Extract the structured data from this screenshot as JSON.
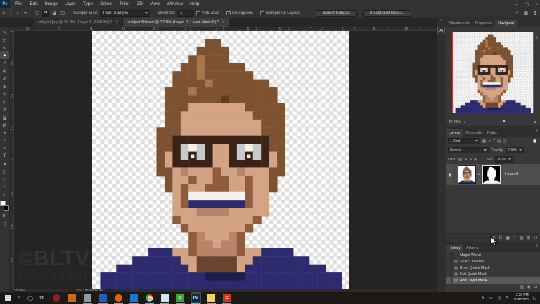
{
  "app": {
    "logo": "Ps",
    "window_controls": {
      "minimize": "–",
      "restore": "▢",
      "close": "×"
    }
  },
  "menu": {
    "items": [
      "File",
      "Edit",
      "Image",
      "Layer",
      "Type",
      "Select",
      "Filter",
      "3D",
      "View",
      "Window",
      "Help"
    ]
  },
  "options_bar": {
    "home_icon": "⌂",
    "tool_icon": "✦",
    "mode_buttons": [
      {
        "name": "new-selection-mode",
        "glyph": "▢",
        "active": false
      },
      {
        "name": "add-to-selection-mode",
        "glyph": "⧉",
        "active": true
      },
      {
        "name": "subtract-selection-mode",
        "glyph": "◪",
        "active": false
      },
      {
        "name": "intersect-selection-mode",
        "glyph": "◫",
        "active": false
      }
    ],
    "sample_size_label": "Sample Size:",
    "sample_size_value": "Point Sample",
    "tolerance_label": "Tolerance:",
    "tolerance_value": "1",
    "checkboxes": [
      {
        "label": "Anti-alias",
        "checked": false
      },
      {
        "label": "Contiguous",
        "checked": true
      },
      {
        "label": "Sample All Layers",
        "checked": false
      }
    ],
    "buttons": [
      {
        "name": "select-subject-button",
        "label": "Select Subject"
      },
      {
        "name": "select-and-mask-button",
        "label": "Select and Mask..."
      }
    ],
    "right_icons": [
      {
        "name": "search-icon",
        "glyph": "⌕"
      },
      {
        "name": "workspace-switcher-icon",
        "glyph": "▦"
      },
      {
        "name": "share-icon",
        "glyph": "↥"
      }
    ]
  },
  "tabs": [
    {
      "label": "subject.jpg @ 33.3% (Layer 1, RGB/8#) *",
      "active": false
    },
    {
      "label": "subject filtered @ 37.8% (Layer 0, Layer Mask/8) *",
      "active": true
    }
  ],
  "toolbar": {
    "tools": [
      {
        "name": "move-tool",
        "glyph": "↖",
        "active": false
      },
      {
        "name": "marquee-tool",
        "glyph": "▭",
        "active": false
      },
      {
        "name": "lasso-tool",
        "glyph": "∿",
        "active": false
      },
      {
        "name": "magic-wand-tool",
        "glyph": "✦",
        "active": true
      },
      {
        "name": "crop-tool",
        "glyph": "#",
        "active": false
      },
      {
        "name": "frame-tool",
        "glyph": "⊠",
        "active": false
      },
      {
        "name": "eyedropper-tool",
        "glyph": "✐",
        "active": false
      },
      {
        "name": "healing-brush-tool",
        "glyph": "⊕",
        "active": false
      },
      {
        "name": "brush-tool",
        "glyph": "✎",
        "active": false
      },
      {
        "name": "clone-stamp-tool",
        "glyph": "⊡",
        "active": false
      },
      {
        "name": "history-brush-tool",
        "glyph": "↺",
        "active": false
      },
      {
        "name": "eraser-tool",
        "glyph": "◪",
        "active": false
      },
      {
        "name": "gradient-tool",
        "glyph": "▨",
        "active": false
      },
      {
        "name": "blur-tool",
        "glyph": "◒",
        "active": false
      },
      {
        "name": "dodge-tool",
        "glyph": "◐",
        "active": false
      },
      {
        "name": "pen-tool",
        "glyph": "✒",
        "active": false
      },
      {
        "name": "type-tool",
        "glyph": "T",
        "active": false
      },
      {
        "name": "path-selection-tool",
        "glyph": "➤",
        "active": false
      },
      {
        "name": "shape-tool",
        "glyph": "▢",
        "active": false
      },
      {
        "name": "hand-tool",
        "glyph": "☞",
        "active": false
      },
      {
        "name": "zoom-tool",
        "glyph": "⌕",
        "active": false
      },
      {
        "name": "edit-toolbar-button",
        "glyph": "⋯",
        "active": false
      }
    ]
  },
  "rulers": {
    "top_numbers": [
      "2",
      "1",
      "0",
      "1",
      "2",
      "3",
      "4",
      "5",
      "6",
      "7",
      "8",
      "9",
      "10"
    ],
    "left_numbers": [
      "0",
      "1",
      "2",
      "3",
      "4",
      "5",
      "6",
      "7"
    ]
  },
  "canvas_area": {
    "watermark_line1": "©BLTV",
    "watermark_line2": "PHOTOSHOP",
    "status_zoom": "37.78%",
    "status_doc": "Doc: 16.0M/14.4M",
    "status_chevron": "›"
  },
  "dock": {
    "collapse_icon": "»",
    "ai_badge": "Ai"
  },
  "navigator": {
    "tabs": [
      {
        "label": "Adjustments",
        "active": false
      },
      {
        "label": "Properties",
        "active": false
      },
      {
        "label": "Navigator",
        "active": true
      }
    ],
    "menu_icon": "≡",
    "zoom_value": "37.78%"
  },
  "layers_panel": {
    "tabs": [
      {
        "label": "Layers",
        "active": true
      },
      {
        "label": "Channels",
        "active": false
      },
      {
        "label": "Paths",
        "active": false
      }
    ],
    "menu_icon": "≡",
    "filter_search_icon": "⌕",
    "filter_label": "Kind",
    "filter_icons": [
      {
        "name": "filter-pixel-layers-icon",
        "glyph": "▦"
      },
      {
        "name": "filter-adjustment-layers-icon",
        "glyph": "◑"
      },
      {
        "name": "filter-type-layers-icon",
        "glyph": "T"
      },
      {
        "name": "filter-shape-layers-icon",
        "glyph": "▤"
      },
      {
        "name": "filter-smart-objects-icon",
        "glyph": "◫"
      }
    ],
    "blend_mode": "Normal",
    "opacity_label": "Opacity:",
    "opacity_value": "100%",
    "lock_label": "Lock:",
    "lock_icons": [
      {
        "name": "lock-transparency-icon",
        "glyph": "▨"
      },
      {
        "name": "lock-pixels-icon",
        "glyph": "✎"
      },
      {
        "name": "lock-position-icon",
        "glyph": "+"
      },
      {
        "name": "lock-artboard-icon",
        "glyph": "⊞"
      },
      {
        "name": "lock-all-icon",
        "glyph": "⊓"
      }
    ],
    "fill_label": "Fill:",
    "fill_value": "100%",
    "layer": {
      "eye_icon": "◉",
      "link_icon": "∞",
      "name": "Layer 0"
    },
    "bottom_icons": [
      {
        "name": "link-layers-icon",
        "glyph": "∞"
      },
      {
        "name": "layer-effects-icon",
        "glyph": "fx"
      },
      {
        "name": "add-layer-mask-icon",
        "glyph": "▣"
      },
      {
        "name": "new-adjustment-layer-icon",
        "glyph": "◑"
      },
      {
        "name": "new-group-icon",
        "glyph": "▤"
      },
      {
        "name": "new-layer-icon",
        "glyph": "⊞"
      },
      {
        "name": "delete-layer-icon",
        "glyph": "⊔"
      }
    ]
  },
  "history_panel": {
    "tabs": [
      {
        "label": "History",
        "active": true
      },
      {
        "label": "Actions",
        "active": false
      }
    ],
    "menu_icon": "≡",
    "items": [
      {
        "label": "Magic Wand",
        "glyph": "✦",
        "selected": false
      },
      {
        "label": "Select Inverse",
        "glyph": "▤",
        "selected": false
      },
      {
        "label": "Enter Quick Mask",
        "glyph": "▤",
        "selected": false
      },
      {
        "label": "Exit Quick Mask",
        "glyph": "▤",
        "selected": false
      },
      {
        "label": "Add Layer Mask",
        "glyph": "▤",
        "selected": true
      }
    ],
    "bottom_icons": [
      {
        "name": "new-document-from-state-icon",
        "glyph": "▥"
      },
      {
        "name": "new-snapshot-icon",
        "glyph": "◉"
      },
      {
        "name": "delete-state-icon",
        "glyph": "⊔"
      }
    ]
  },
  "taskbar": {
    "search_icon": "⌕",
    "cortana_icon": "◯",
    "task_view_icon": "⧉",
    "apps": [
      {
        "name": "app-record",
        "shape": "circle",
        "color": "#8b2020",
        "label": "",
        "running": false
      },
      {
        "name": "app-orange-tile",
        "shape": "square",
        "color": "#c96a1e",
        "label": "",
        "running": false
      },
      {
        "name": "app-windows-gray",
        "shape": "square",
        "color": "#8e9ba6",
        "label": "",
        "running": true
      },
      {
        "name": "app-blue-tile",
        "shape": "square",
        "color": "#1e5fbf",
        "label": "",
        "running": true
      },
      {
        "name": "app-firefox",
        "shape": "circle",
        "color": "#e66000",
        "label": "",
        "running": true
      },
      {
        "name": "app-outlook",
        "shape": "square",
        "color": "#1976d2",
        "label": "",
        "running": true
      },
      {
        "name": "app-chrome",
        "shape": "chrome",
        "color": "",
        "label": "",
        "running": true
      },
      {
        "name": "app-photos",
        "shape": "square",
        "color": "#cfe3f5",
        "label": "",
        "running": true
      },
      {
        "name": "app-green-c",
        "shape": "square",
        "color": "#3da639",
        "label": "C",
        "running": true
      },
      {
        "name": "app-photoshop",
        "shape": "square",
        "color": "#0b2a42",
        "label": "Ps",
        "running": true,
        "active": true
      },
      {
        "name": "app-file-explorer",
        "shape": "square",
        "color": "#f3cf63",
        "label": "",
        "running": true
      },
      {
        "name": "app-red-c",
        "shape": "square",
        "color": "#d93025",
        "label": "C",
        "running": true
      }
    ],
    "tray_icons": [
      {
        "name": "tray-chevron-icon",
        "glyph": "∧"
      },
      {
        "name": "tray-network-icon",
        "glyph": "▭"
      },
      {
        "name": "tray-volume-icon",
        "glyph": "◁)"
      },
      {
        "name": "tray-pen-icon",
        "glyph": "✎"
      }
    ],
    "clock": {
      "time": "2:20 PM",
      "date": "2/29/2020"
    },
    "action_center_icon": "❑"
  },
  "pixel_art": {
    "checker_light": "#ffffff",
    "checker_dark": "#e0e0e0",
    "mask_bg": "#000000",
    "mask_fg": "#ffffff",
    "palette": {
      "h": "#7d5231",
      "H": "#5e3c22",
      "L": "#a5774a",
      "s": "#d4a384",
      "S": "#b9836a",
      "d": "#8f5c3d",
      "D": "#6b4430",
      "f": "#3a2418",
      "g": "#c7c9cc",
      "w": "#f2f1ee",
      "b": "#2e2a6e",
      "B": "#201c4e"
    },
    "grid": [
      "................................",
      "..............hh................",
      ".............hhhh...............",
      "............hLhhh...............",
      "...........hhLhhhhh.............",
      "..........hhhLhhhhhh............",
      "..........hhhhLhhhhhhh..........",
      ".........hhhLhhhhhhhhhh.........",
      ".........hhhhhhhHhhhhhh.........",
      ".........hhhssssssshhhhh........",
      ".........hhssssssssshhhh........",
      ".........hhsssssssssshhh........",
      "........hhhsssssssssshhh........",
      "........hhffffffffffffhh........",
      "........hhfgwgfssfgwgfhh........",
      "........hsfgegfssfgegfsh........",
      "........hsfffffssfffffsh........",
      "........hhsSsssdssSssshh........",
      ".........hssdssddssdssh.........",
      ".........hsdssdddssdssh.........",
      "..........sdwwwwwwwdss..........",
      "..........sdbbbbbbbdss..........",
      "..........sssSSSSsssss..........",
      "..........dsssssssssd...........",
      "...........dsssssssd............",
      "............dSsssSd.............",
      "............dSSsSSd.............",
      ".......bbbssdSSSSSdssbbbb.......",
      ".....bbbbbbssDDDDDssbbbbbbb.....",
      "...bbbbbbbbbsDDDDDsbbbbbbbbbb...",
      ".bbbbbbbbbbbbbBBBBBbbbbbbbbbbbb.",
      ".bbbbbbbbbbbbbbbbbbbbbbbbbbbbbb."
    ]
  }
}
